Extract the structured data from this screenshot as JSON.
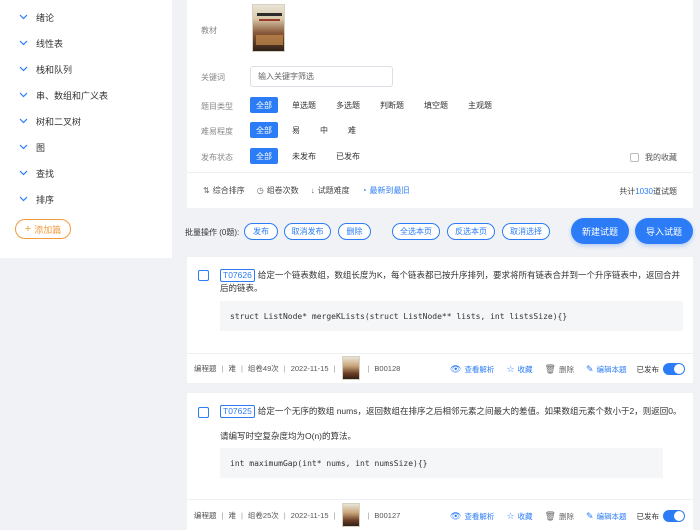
{
  "sidebar": {
    "chapters": [
      "绪论",
      "线性表",
      "栈和队列",
      "串、数组和广义表",
      "树和二叉树",
      "图",
      "查找",
      "排序"
    ],
    "add_label": "添加篇"
  },
  "filters": {
    "textbook_label": "教材",
    "keyword_label": "关键词",
    "keyword_placeholder": "输入关键字筛选",
    "type_label": "题目类型",
    "type_options": [
      "全部",
      "单选题",
      "多选题",
      "判断题",
      "填空题",
      "主观题"
    ],
    "difficulty_label": "难易程度",
    "difficulty_options": [
      "全部",
      "易",
      "中",
      "难"
    ],
    "status_label": "发布状态",
    "status_options": [
      "全部",
      "未发布",
      "已发布"
    ],
    "favorites_label": "我的收藏"
  },
  "sort": {
    "options": [
      "综合排序",
      "组卷次数",
      "试题难度",
      "最新到最旧"
    ],
    "active_index": 3,
    "total_prefix": "共计",
    "total_count": "1030",
    "total_suffix": "道试题"
  },
  "batch": {
    "label": "批量操作 (0题):",
    "actions": [
      "发布",
      "取消发布",
      "删除",
      "全选本页",
      "反选本页",
      "取消选择"
    ],
    "new_question": "新建试题",
    "import_question": "导入试题"
  },
  "questions": [
    {
      "id": "T07626",
      "stem": "给定一个链表数组，数组长度为K，每个链表都已按升序排列，要求将所有链表合并到一个升序链表中，返回合并后的链表。",
      "note": "",
      "code": "struct ListNode* mergeKLists(struct ListNode** lists, int listsSize){}",
      "type": "编程题",
      "difficulty": "难",
      "used": "组卷49次",
      "date": "2022-11-15",
      "code_no": "B00128",
      "status": "已发布"
    },
    {
      "id": "T07625",
      "stem": "给定一个无序的数组 nums，返回数组在排序之后相邻元素之间最大的差值。如果数组元素个数小于2，则返回0。",
      "note": "请编写时空复杂度均为O(n)的算法。",
      "code": "int maximumGap(int* nums, int numsSize){}",
      "type": "编程题",
      "difficulty": "难",
      "used": "组卷25次",
      "date": "2022-11-15",
      "code_no": "B00127",
      "status": "已发布"
    }
  ],
  "question_actions": {
    "view": "查看解析",
    "favorite": "收藏",
    "delete": "删除",
    "edit": "编辑本题"
  },
  "colors": {
    "accent": "#2b7cf6",
    "add_chapter": "#f29b3d"
  }
}
